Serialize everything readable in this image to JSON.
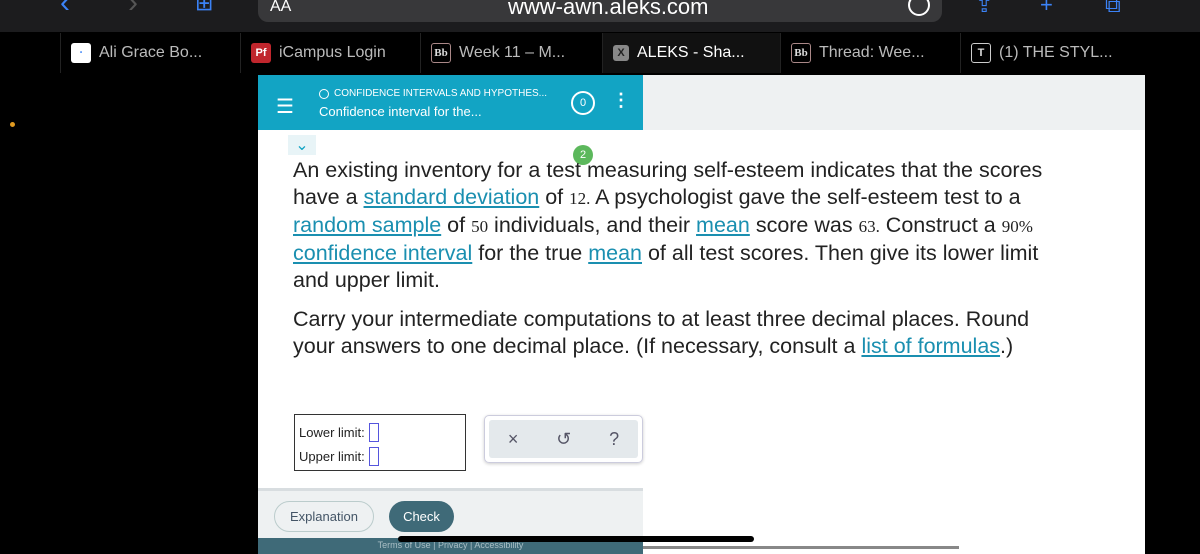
{
  "browser": {
    "url": "www-awn.aleks.com",
    "reader_label": "AA",
    "tabs": [
      {
        "label": "Ali Grace Bo...",
        "icon": "site-icon"
      },
      {
        "label": "iCampus Login",
        "icon": "pf-icon"
      },
      {
        "label": "Week 11 – M...",
        "icon": "bb-icon"
      },
      {
        "label": "ALEKS - Sha...",
        "icon": "x-icon",
        "active": true
      },
      {
        "label": "Thread: Wee...",
        "icon": "bb-icon"
      },
      {
        "label": "(1) THE STYL...",
        "icon": "t-icon"
      }
    ]
  },
  "header": {
    "topic": "CONFIDENCE INTERVALS AND HYPOTHES...",
    "subtitle": "Confidence interval for the...",
    "count": "0",
    "accent": "#12a4c4"
  },
  "badge": "2",
  "question": {
    "p1": [
      {
        "t": "An existing inventory for a test measuring self-esteem indicates that the scores have a "
      },
      {
        "t": "standard deviation",
        "link": true
      },
      {
        "t": " of "
      },
      {
        "t": "12.",
        "num": true
      },
      {
        "t": " A psychologist gave the self-esteem test to a "
      },
      {
        "t": "random sample",
        "link": true
      },
      {
        "t": " of "
      },
      {
        "t": "50",
        "num": true
      },
      {
        "t": " individuals, and their "
      },
      {
        "t": "mean",
        "link": true
      },
      {
        "t": " score was "
      },
      {
        "t": "63.",
        "num": true
      },
      {
        "t": " Construct a "
      },
      {
        "t": "90%",
        "num": true
      },
      {
        "t": " "
      },
      {
        "t": "confidence interval",
        "link": true
      },
      {
        "t": " for the true "
      },
      {
        "t": "mean",
        "link": true
      },
      {
        "t": " of all test scores. Then give its lower limit and upper limit."
      }
    ],
    "p2": [
      {
        "t": "Carry your intermediate computations to at least three decimal places. Round your answers to one decimal place. (If necessary, consult a "
      },
      {
        "t": "list of formulas",
        "link": true
      },
      {
        "t": ".)"
      }
    ]
  },
  "answer": {
    "lower_label": "Lower limit:",
    "upper_label": "Upper limit:",
    "lower_value": "",
    "upper_value": ""
  },
  "tools": {
    "clear": "×",
    "undo": "↺",
    "help": "?"
  },
  "footer": {
    "explanation": "Explanation",
    "check": "Check",
    "legal": "Terms of Use  |  Privacy  |  Accessibility"
  }
}
